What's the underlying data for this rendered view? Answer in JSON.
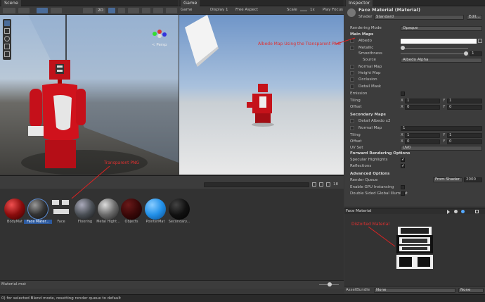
{
  "scene": {
    "tab": "Scene",
    "mode_2d": "2D",
    "persp": "< Persp"
  },
  "game": {
    "tab": "Game",
    "display_mode": "Game",
    "display": "Display 1",
    "aspect": "Free Aspect",
    "scale_label": "Scale",
    "scale_value": "1x",
    "play_focused": "Play Focus"
  },
  "inspector": {
    "tab": "Inspector",
    "material_name": "Face Material (Material)",
    "shader_label": "Shader",
    "shader_value": "Standard",
    "edit_label": "Edit...",
    "rendering_mode_label": "Rendering Mode",
    "rendering_mode_value": "Opaque",
    "main_maps": "Main Maps",
    "albedo": "Albedo",
    "metallic": "Metallic",
    "smoothness": "Smoothness",
    "smoothness_value": "1",
    "source": "Source",
    "source_value": "Albedo Alpha",
    "normal_map": "Normal Map",
    "height_map": "Height Map",
    "occlusion": "Occlusion",
    "detail_mask": "Detail Mask",
    "emission": "Emission",
    "tiling": "Tiling",
    "offset": "Offset",
    "x": "X",
    "y": "Y",
    "tiling_x": "1",
    "tiling_y": "1",
    "offset_x": "0",
    "offset_y": "0",
    "secondary_maps": "Secondary Maps",
    "detail_albedo": "Detail Albedo x2",
    "normal_map2": "Normal Map",
    "normal_map2_value": "1",
    "tiling2_x": "1",
    "tiling2_y": "1",
    "offset2_x": "0",
    "offset2_y": "0",
    "uv_set": "UV Set",
    "uv_set_value": "UV0",
    "forward_options": "Forward Rendering Options",
    "specular_highlights": "Specular Highlights",
    "reflections": "Reflections",
    "advanced_options": "Advanced Options",
    "render_queue": "Render Queue",
    "render_queue_mode": "From Shader",
    "render_queue_value": "2000",
    "gpu_instancing": "Enable GPU Instancing",
    "double_sided_gi": "Double Sided Global Illuminat",
    "preview_title": "Face Material",
    "asset_bundle": "AssetBundle",
    "asset_bundle_value": "None",
    "asset_variant_value": "None"
  },
  "project": {
    "materials": [
      {
        "name": "BodyMat",
        "color": "#8b0d0d"
      },
      {
        "name": "Face Mater...",
        "color": "face"
      },
      {
        "name": "Face",
        "color": "flat"
      },
      {
        "name": "Flooring",
        "color": "#4a4f55"
      },
      {
        "name": "Metal Hight...",
        "color": "#6a6a6a"
      },
      {
        "name": "Objects",
        "color": "#3a0808"
      },
      {
        "name": "PointerMat",
        "color": "#2290e8"
      },
      {
        "name": "Secondary...",
        "color": "#111111"
      }
    ],
    "search_count": "18",
    "path": "Material.mat"
  },
  "status": {
    "message": "0) for selected Blend mode, resetting render queue to default"
  },
  "annotations": {
    "albedo_note": "Albedo Map Using the Transparent PNG",
    "transparent_note": "Transparent PNG",
    "distorted_note": "Distorted Material"
  }
}
